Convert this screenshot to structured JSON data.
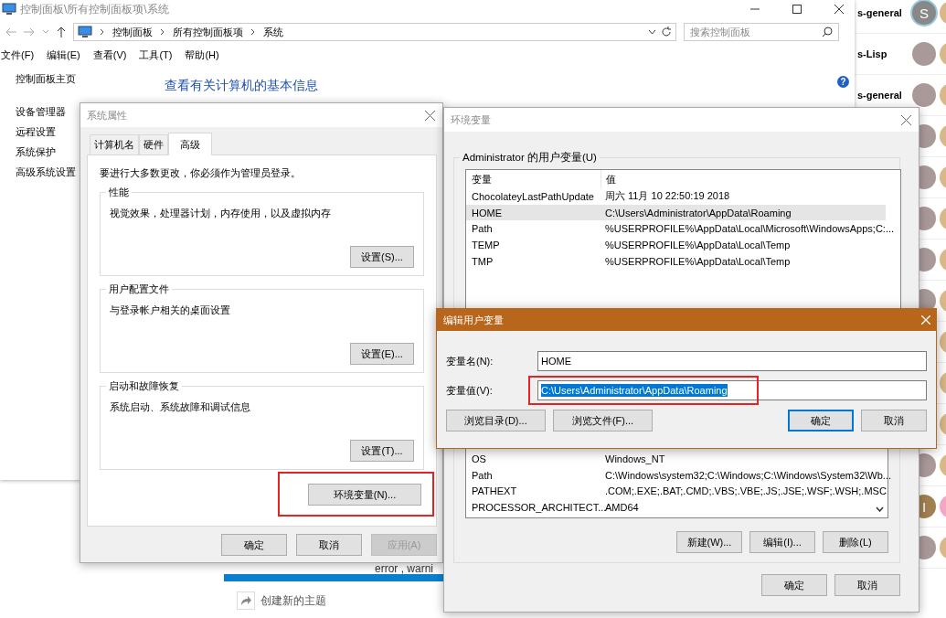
{
  "chat_list": [
    {
      "channel": "s-general",
      "initial": "S"
    },
    {
      "channel": "s-Lisp"
    },
    {
      "channel": "s-general"
    }
  ],
  "avatar_initials": [
    "I"
  ],
  "background_page": {
    "text": "error , warni",
    "action": "创建新的主题"
  },
  "control_panel": {
    "title": "控制面板\\所有控制面板项\\系统",
    "address": [
      "控制面板",
      "所有控制面板项",
      "系统"
    ],
    "search_placeholder": "搜索控制面板",
    "menu": [
      "文件(F)",
      "编辑(E)",
      "查看(V)",
      "工具(T)",
      "帮助(H)"
    ],
    "sidebar": [
      "控制面板主页",
      "设备管理器",
      "远程设置",
      "系统保护",
      "高级系统设置"
    ],
    "heading": "查看有关计算机的基本信息",
    "help": "?"
  },
  "system_properties": {
    "title": "系统属性",
    "tabs": [
      {
        "label": "计算机名",
        "selected": false
      },
      {
        "label": "硬件",
        "selected": false
      },
      {
        "label": "高级",
        "selected": true
      }
    ],
    "notice": "要进行大多数更改，你必须作为管理员登录。",
    "groups": [
      {
        "title": "性能",
        "description": "视觉效果，处理器计划，内存使用，以及虚拟内存",
        "button": "设置(S)..."
      },
      {
        "title": "用户配置文件",
        "description": "与登录帐户相关的桌面设置",
        "button": "设置(E)..."
      },
      {
        "title": "启动和故障恢复",
        "description": "系统启动、系统故障和调试信息",
        "button": "设置(T)..."
      }
    ],
    "env_button": "环境变量(N)...",
    "buttons": [
      {
        "label": "确定",
        "disabled": false
      },
      {
        "label": "取消",
        "disabled": false
      },
      {
        "label": "应用(A)",
        "disabled": true
      }
    ]
  },
  "env_vars": {
    "title": "环境变量",
    "user_group": "Administrator 的用户变量(U)",
    "columns": [
      "变量",
      "值"
    ],
    "user_rows": [
      {
        "name": "ChocolateyLastPathUpdate",
        "value": "周六 11月 10 22:50:19 2018",
        "selected": false
      },
      {
        "name": "HOME",
        "value": "C:\\Users\\Administrator\\AppData\\Roaming",
        "selected": true
      },
      {
        "name": "Path",
        "value": "%USERPROFILE%\\AppData\\Local\\Microsoft\\WindowsApps;C:...",
        "selected": false
      },
      {
        "name": "TEMP",
        "value": "%USERPROFILE%\\AppData\\Local\\Temp",
        "selected": false
      },
      {
        "name": "TMP",
        "value": "%USERPROFILE%\\AppData\\Local\\Temp",
        "selected": false
      }
    ],
    "system_rows": [
      {
        "name": "OS",
        "value": "Windows_NT",
        "selected": false
      },
      {
        "name": "Path",
        "value": "C:\\Windows\\system32;C:\\Windows;C:\\Windows\\System32\\Wb...",
        "selected": false
      },
      {
        "name": "PATHEXT",
        "value": ".COM;.EXE;.BAT;.CMD;.VBS;.VBE;.JS;.JSE;.WSF;.WSH;.MSC",
        "selected": false
      },
      {
        "name": "PROCESSOR_ARCHITECT...",
        "value": "AMD64",
        "selected": false
      }
    ],
    "system_buttons": [
      "新建(W)...",
      "编辑(I)...",
      "删除(L)"
    ],
    "buttons": [
      "确定",
      "取消"
    ]
  },
  "edit_dialog": {
    "title": "编辑用户变量",
    "fields": [
      {
        "label": "变量名(N):",
        "value": "HOME",
        "text_selected": false
      },
      {
        "label": "变量值(V):",
        "value": "C:\\Users\\Administrator\\AppData\\Roaming",
        "text_selected": true
      }
    ],
    "browse_buttons": [
      "浏览目录(D)...",
      "浏览文件(F)..."
    ],
    "buttons": [
      {
        "label": "确定",
        "default": true
      },
      {
        "label": "取消",
        "default": false
      }
    ]
  }
}
